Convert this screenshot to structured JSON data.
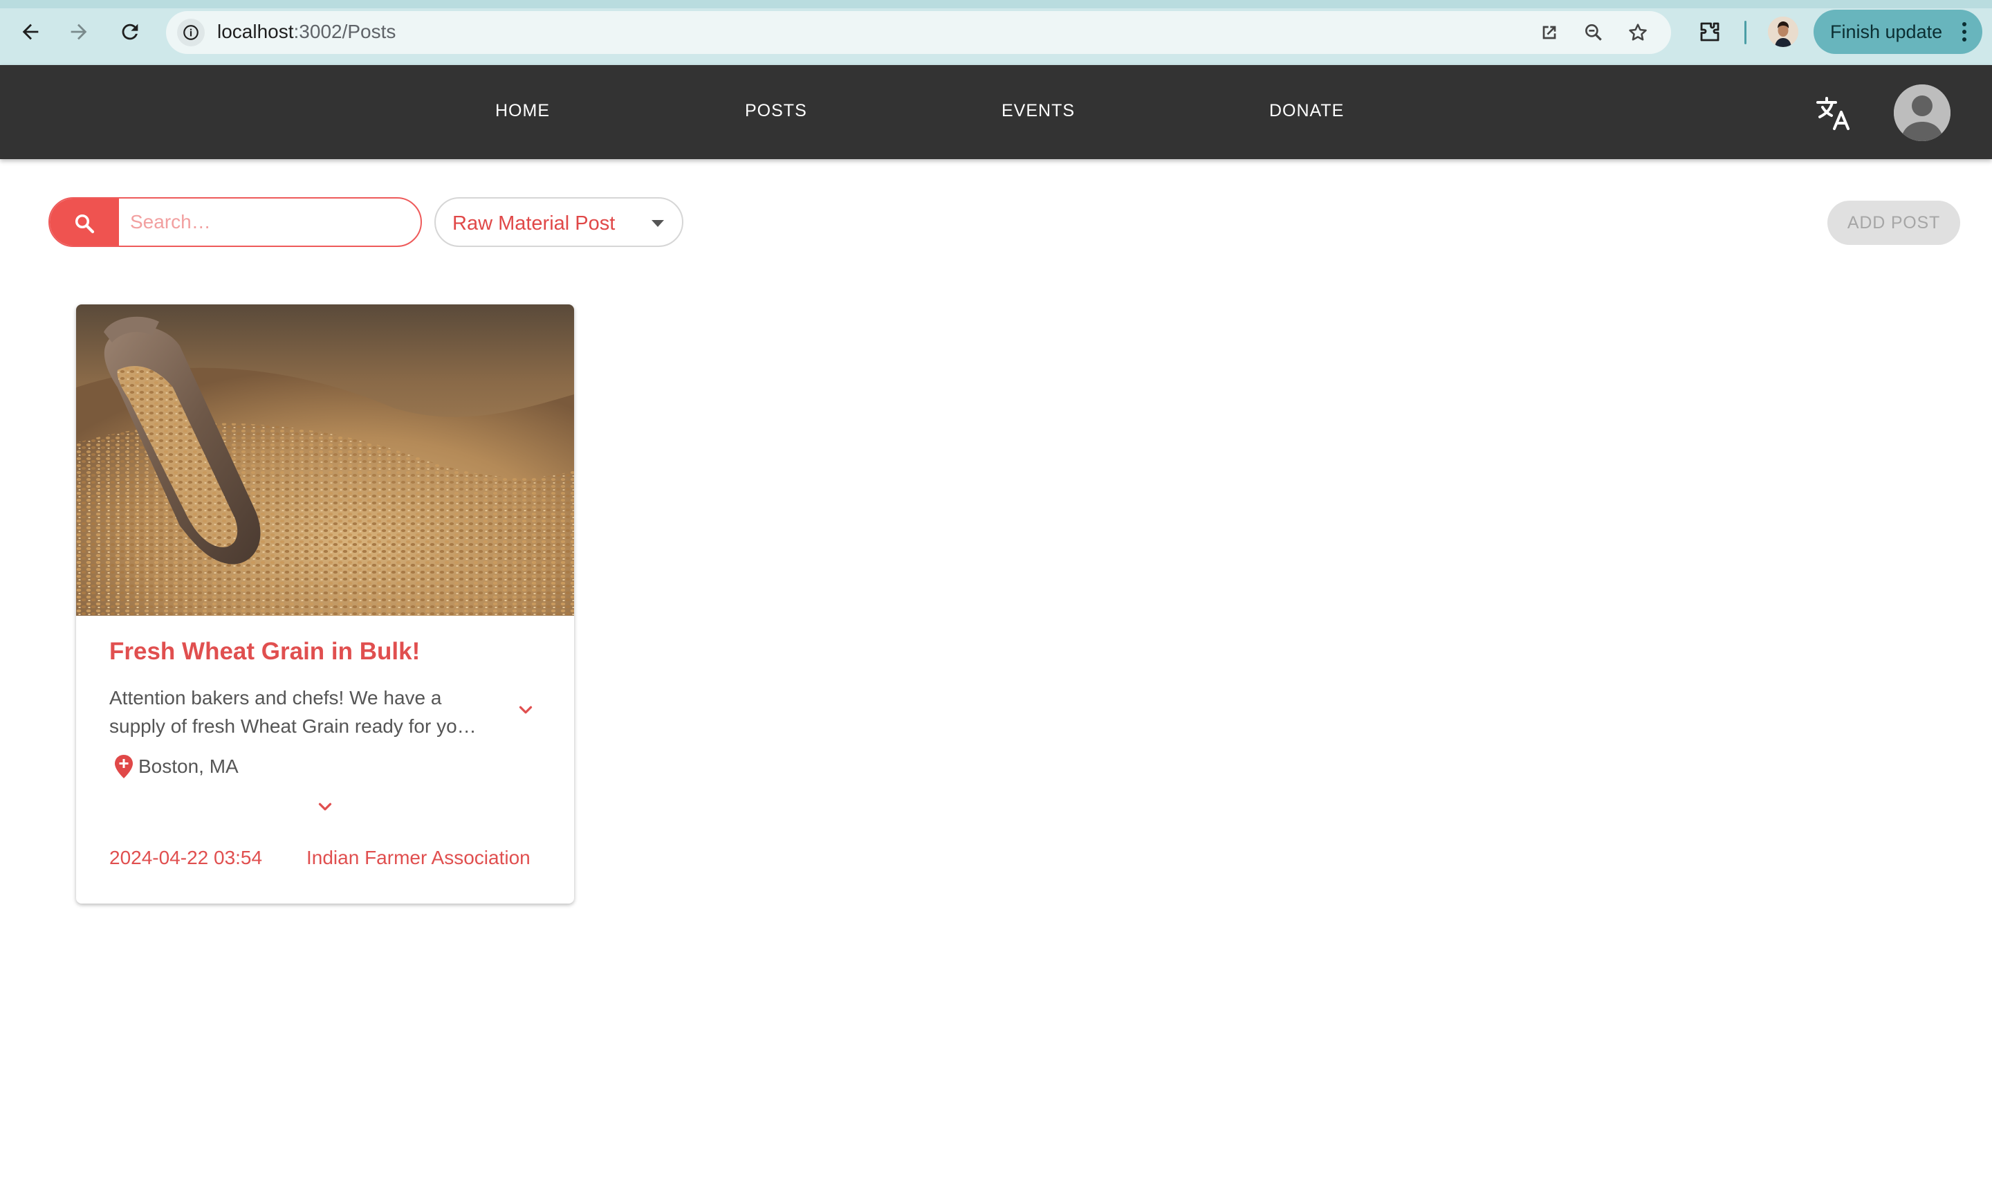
{
  "browser": {
    "url_host": "localhost",
    "url_path": ":3002/Posts",
    "finish_update_label": "Finish update",
    "icons": [
      "back-arrow-icon",
      "forward-arrow-icon",
      "reload-icon",
      "info-icon",
      "open-in-new-icon",
      "zoom-icon",
      "star-icon",
      "extensions-icon",
      "kebab-menu-icon"
    ]
  },
  "header": {
    "nav": [
      {
        "label": "HOME"
      },
      {
        "label": "POSTS"
      },
      {
        "label": "EVENTS"
      },
      {
        "label": "DONATE"
      }
    ],
    "icons": [
      "translate-icon",
      "avatar-icon"
    ]
  },
  "toolbar": {
    "search_placeholder": "Search…",
    "search_value": "",
    "filter_value": "Raw Material Post",
    "add_post_label": "ADD POST"
  },
  "posts": [
    {
      "title": "Fresh Wheat Grain in Bulk!",
      "description_line1": "Attention bakers and chefs! We have a",
      "description_line2": "supply of fresh Wheat Grain ready for yo…",
      "location": "Boston, MA",
      "date": "2024-04-22 03:54",
      "author": "Indian Farmer Association"
    }
  ],
  "colors": {
    "accent": "#ef5350",
    "appbar": "#333333",
    "chrome": "#cfe8ea",
    "finish_button": "#68b5bd"
  }
}
